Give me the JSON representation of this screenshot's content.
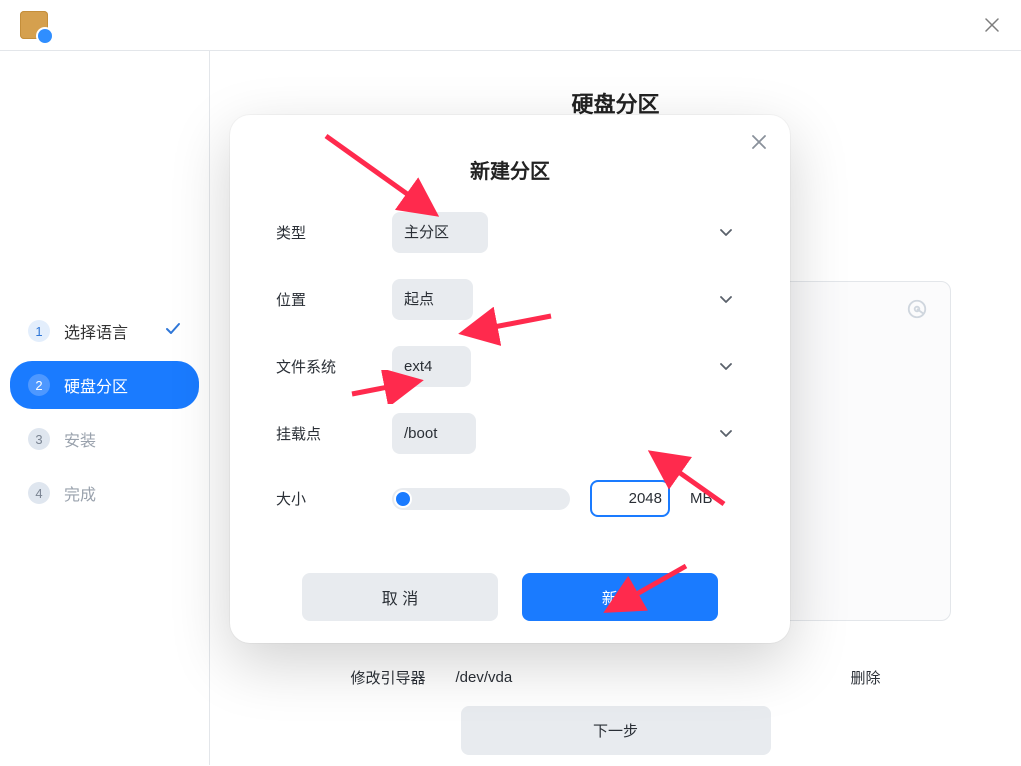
{
  "page": {
    "title": "硬盘分区"
  },
  "sidebar": {
    "steps": [
      {
        "num": "1",
        "label": "选择语言"
      },
      {
        "num": "2",
        "label": "硬盘分区"
      },
      {
        "num": "3",
        "label": "安装"
      },
      {
        "num": "4",
        "label": "完成"
      }
    ]
  },
  "bottom": {
    "boot_label": "修改引导器",
    "boot_value": "/dev/vda",
    "delete_label": "删除",
    "next_label": "下一步"
  },
  "modal": {
    "title": "新建分区",
    "rows": {
      "type": {
        "label": "类型",
        "value": "主分区"
      },
      "pos": {
        "label": "位置",
        "value": "起点"
      },
      "fs": {
        "label": "文件系统",
        "value": "ext4"
      },
      "mount": {
        "label": "挂载点",
        "value": "/boot"
      },
      "size": {
        "label": "大小",
        "value": "2048",
        "unit": "MB"
      }
    },
    "buttons": {
      "cancel": "取 消",
      "create": "新 建"
    }
  }
}
